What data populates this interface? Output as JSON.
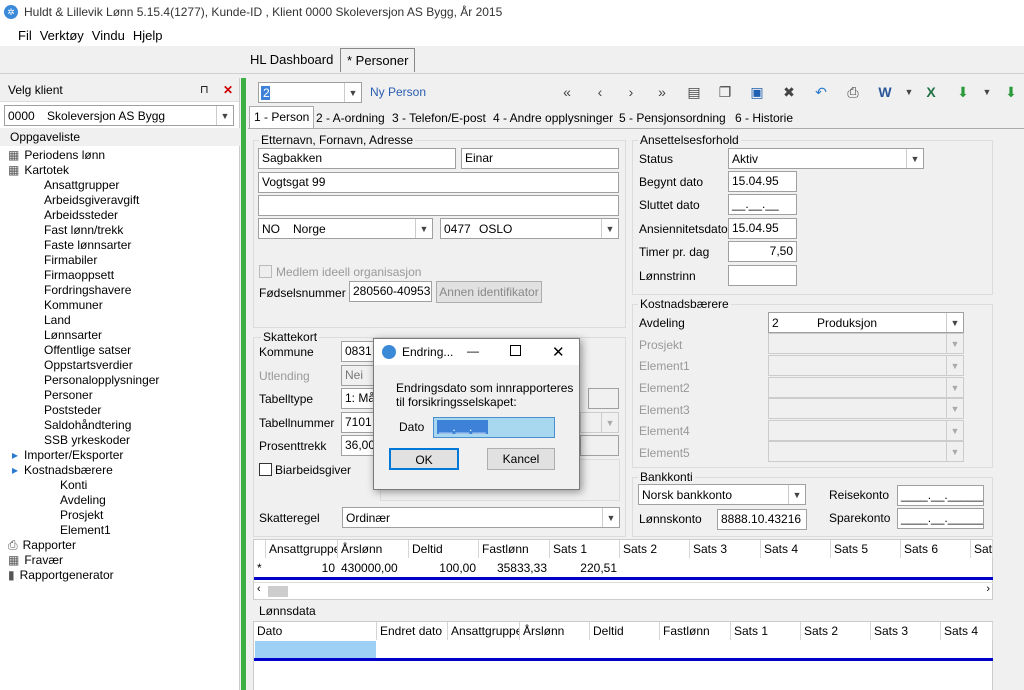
{
  "window": {
    "title": "Huldt & Lillevik Lønn 5.15.4(1277), Kunde-ID , Klient 0000 Skoleversjon AS Bygg, År 2015"
  },
  "menu": [
    "Fil",
    "Verktøy",
    "Vindu",
    "Hjelp"
  ],
  "doc_tabs": [
    "HL Dashboard",
    "* Personer"
  ],
  "left": {
    "header": "Velg klient",
    "client_code": "0000",
    "client_name": "Skoleversjon AS Bygg",
    "tasklist": "Oppgaveliste",
    "tree": [
      {
        "label": "Periodens lønn",
        "level": 0,
        "icon": "grid-icon"
      },
      {
        "label": "Kartotek",
        "level": 0,
        "icon": "grid-icon"
      },
      {
        "label": "Ansattgrupper",
        "level": 2
      },
      {
        "label": "Arbeidsgiveravgift",
        "level": 2
      },
      {
        "label": "Arbeidssteder",
        "level": 2
      },
      {
        "label": "Fast lønn/trekk",
        "level": 2
      },
      {
        "label": "Faste lønnsarter",
        "level": 2
      },
      {
        "label": "Firmabiler",
        "level": 2
      },
      {
        "label": "Firmaoppsett",
        "level": 2
      },
      {
        "label": "Fordringshavere",
        "level": 2
      },
      {
        "label": "Kommuner",
        "level": 2
      },
      {
        "label": "Land",
        "level": 2
      },
      {
        "label": "Lønnsarter",
        "level": 2
      },
      {
        "label": "Offentlige satser",
        "level": 2
      },
      {
        "label": "Oppstartsverdier",
        "level": 2
      },
      {
        "label": "Personalopplysninger",
        "level": 2
      },
      {
        "label": "Personer",
        "level": 2
      },
      {
        "label": "Poststeder",
        "level": 2
      },
      {
        "label": "Saldohåndtering",
        "level": 2
      },
      {
        "label": "SSB yrkeskoder",
        "level": 2
      },
      {
        "label": "Importer/Eksporter",
        "level": 1,
        "expander": true
      },
      {
        "label": "Kostnadsbærere",
        "level": 1,
        "expander": true
      },
      {
        "label": "Konti",
        "level": 3
      },
      {
        "label": "Avdeling",
        "level": 3
      },
      {
        "label": "Prosjekt",
        "level": 3
      },
      {
        "label": "Element1",
        "level": 3
      },
      {
        "label": "Rapporter",
        "level": 0,
        "icon": "print-icon"
      },
      {
        "label": "Fravær",
        "level": 0,
        "icon": "calendar-icon"
      },
      {
        "label": "Rapportgenerator",
        "level": 0,
        "icon": "chart-icon"
      }
    ]
  },
  "toolbar": {
    "person_no": "2",
    "new_person": "Ny Person"
  },
  "tabs": [
    "1 - Person",
    "2 - A-ordning",
    "3 - Telefon/E-post",
    "4 - Andre opplysninger",
    "5 - Pensjonsordning",
    "6 - Historie"
  ],
  "person": {
    "group_title": "Etternavn, Fornavn, Adresse",
    "lastname": "Sagbakken",
    "firstname": "Einar",
    "address1": "Vogtsgat 99",
    "address2": "",
    "country_code": "NO",
    "country": "Norge",
    "zip": "0477",
    "city": "OSLO",
    "ideal_org": "Medlem ideell organisasjon",
    "birth_label": "Fødselsnummer",
    "birth_no": "280560-40953",
    "other_id": "Annen identifikator"
  },
  "employment": {
    "title": "Ansettelsesforhold",
    "status_label": "Status",
    "status": "Aktiv",
    "start_label": "Begynt dato",
    "start": "15.04.95",
    "end_label": "Sluttet dato",
    "end": "__.__.__",
    "seniority_label": "Ansiennitetsdato",
    "seniority": "15.04.95",
    "hours_label": "Timer pr. dag",
    "hours": "7,50",
    "wage_level_label": "Lønnstrinn",
    "wage_level": ""
  },
  "cost": {
    "title": "Kostnadsbærere",
    "dept_label": "Avdeling",
    "dept_no": "2",
    "dept_name": "Produksjon",
    "project": "Prosjekt",
    "e1": "Element1",
    "e2": "Element2",
    "e3": "Element3",
    "e4": "Element4",
    "e5": "Element5"
  },
  "tax": {
    "title": "Skattekort",
    "municipality_label": "Kommune",
    "municipality": "0831",
    "foreign_label": "Utlending",
    "foreign": "Nei",
    "table_type_label": "Tabelltype",
    "table_type": "1: Må",
    "table_no_label": "Tabellnummer",
    "table_no": "7101",
    "percent_label": "Prosenttrekk",
    "percent": "36,00",
    "side_job": "Biarbeidsgiver",
    "rule_label": "Skatteregel",
    "rule": "Ordinær"
  },
  "bank": {
    "title": "Bankkonti",
    "type": "Norsk bankkonto",
    "wage_label": "Lønnskonto",
    "wage_account": "8888.10.43216",
    "travel_label": "Reisekonto",
    "travel": "____.__.______",
    "savings_label": "Sparekonto",
    "savings": "____.__.______"
  },
  "wage_grid": {
    "columns": [
      "Ansattgruppe",
      "Årslønn",
      "Deltid",
      "Fastlønn",
      "Sats 1",
      "Sats 2",
      "Sats 3",
      "Sats 4",
      "Sats 5",
      "Sats 6",
      "Sats"
    ],
    "row": [
      "10",
      "430000,00",
      "100,00",
      "35833,33",
      "220,51"
    ],
    "marker": "*"
  },
  "wage_data": {
    "title": "Lønnsdata",
    "columns": [
      "Dato",
      "Endret dato",
      "Ansattgruppe",
      "Årslønn",
      "Deltid",
      "Fastlønn",
      "Sats 1",
      "Sats 2",
      "Sats 3",
      "Sats 4"
    ]
  },
  "dialog": {
    "title": "Endring...",
    "message": "Endringsdato som innrapporteres til forsikringsselskapet:",
    "date_label": "Dato",
    "date_value": "__.__.__",
    "ok": "OK",
    "cancel": "Kancel"
  }
}
